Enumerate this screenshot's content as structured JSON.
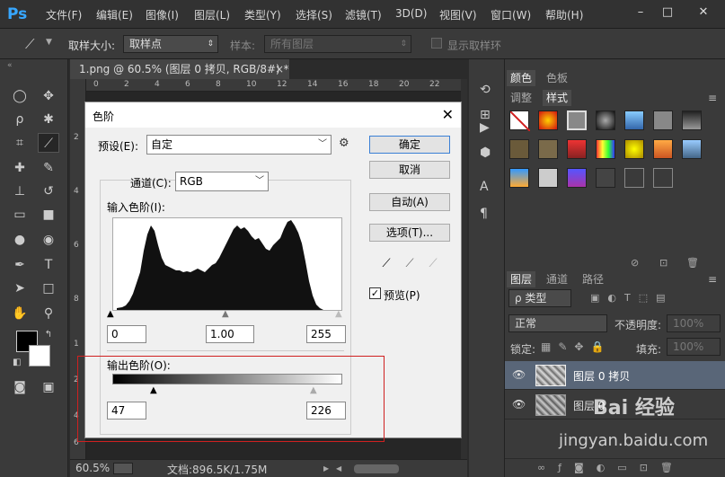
{
  "app": {
    "logo": "Ps"
  },
  "menu": [
    "文件(F)",
    "编辑(E)",
    "图像(I)",
    "图层(L)",
    "类型(Y)",
    "选择(S)",
    "滤镜(T)",
    "3D(D)",
    "视图(V)",
    "窗口(W)",
    "帮助(H)"
  ],
  "window_controls": {
    "minimize": "–",
    "maximize": "□",
    "close": "✕"
  },
  "options_bar": {
    "sample_size_label": "取样大小:",
    "sample_size_value": "取样点",
    "sample_label": "样本:",
    "sample_value": "所有图层",
    "show_ring_label": "显示取样环"
  },
  "document": {
    "tab_title": "1.png @ 60.5% (图层 0 拷贝, RGB/8#) *",
    "tab_close": "×",
    "ruler_top": [
      "0",
      "2",
      "4",
      "6",
      "8",
      "10",
      "12",
      "14",
      "16",
      "18",
      "20",
      "22"
    ],
    "ruler_left": [
      "2",
      "4",
      "6",
      "8",
      "1",
      "2",
      "4",
      "6"
    ],
    "zoom": "60.5%",
    "doc_info": "文档:896.5K/1.75M"
  },
  "right_panel": {
    "tabs_top": [
      "颜色",
      "色板"
    ],
    "tabs_mid": [
      "调整",
      "样式"
    ],
    "active_mid": "样式",
    "layers_tabs": [
      "图层",
      "通道",
      "路径"
    ],
    "filter_label": "ρ 类型",
    "blend_mode": "正常",
    "opacity_label": "不透明度:",
    "opacity_value": "100%",
    "lock_label": "锁定:",
    "fill_label": "填充:",
    "fill_value": "100%",
    "layers": [
      {
        "name": "图层 0 拷贝",
        "selected": true
      },
      {
        "name": "图层 0",
        "selected": false
      }
    ]
  },
  "levels_dialog": {
    "title": "色阶",
    "close": "✕",
    "preset_label": "预设(E):",
    "preset_value": "自定",
    "channel_label": "通道(C):",
    "channel_value": "RGB",
    "input_levels_label": "输入色阶(I):",
    "input_black": "0",
    "input_gamma": "1.00",
    "input_white": "255",
    "output_levels_label": "输出色阶(O):",
    "output_black": "47",
    "output_white": "226",
    "buttons": {
      "ok": "确定",
      "cancel": "取消",
      "auto": "自动(A)",
      "options": "选项(T)..."
    },
    "preview_label": "预览(P)",
    "preview_checked": true
  },
  "watermark": {
    "brand": "Bai 经验",
    "url": "jingyan.baidu.com"
  },
  "colors": {
    "accent": "#3a7fd5",
    "ps_blue": "#37a7ff",
    "highlight_red": "#d02020",
    "selected_layer": "#596678"
  }
}
